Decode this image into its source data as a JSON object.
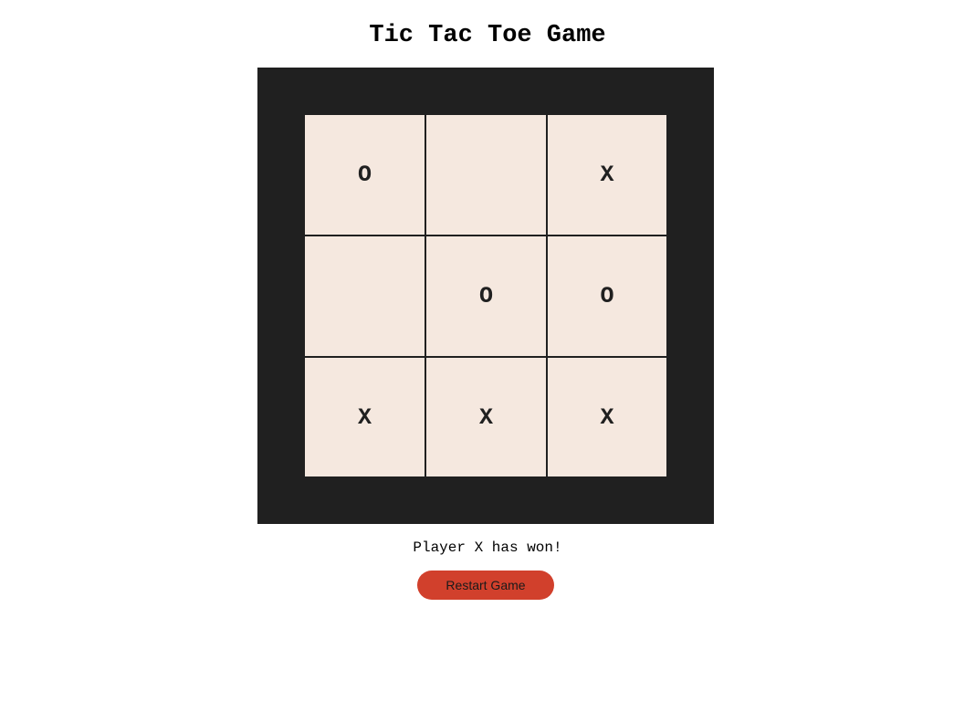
{
  "page": {
    "title": "Tic Tac Toe Game"
  },
  "board": {
    "cells": [
      "O",
      "",
      "X",
      "",
      "O",
      "O",
      "X",
      "X",
      "X"
    ]
  },
  "status": {
    "message": "Player X has won!"
  },
  "controls": {
    "restart_label": "Restart Game"
  },
  "colors": {
    "frame": "#202020",
    "cell_background": "#f5e8df",
    "restart_button": "#d1402c"
  }
}
